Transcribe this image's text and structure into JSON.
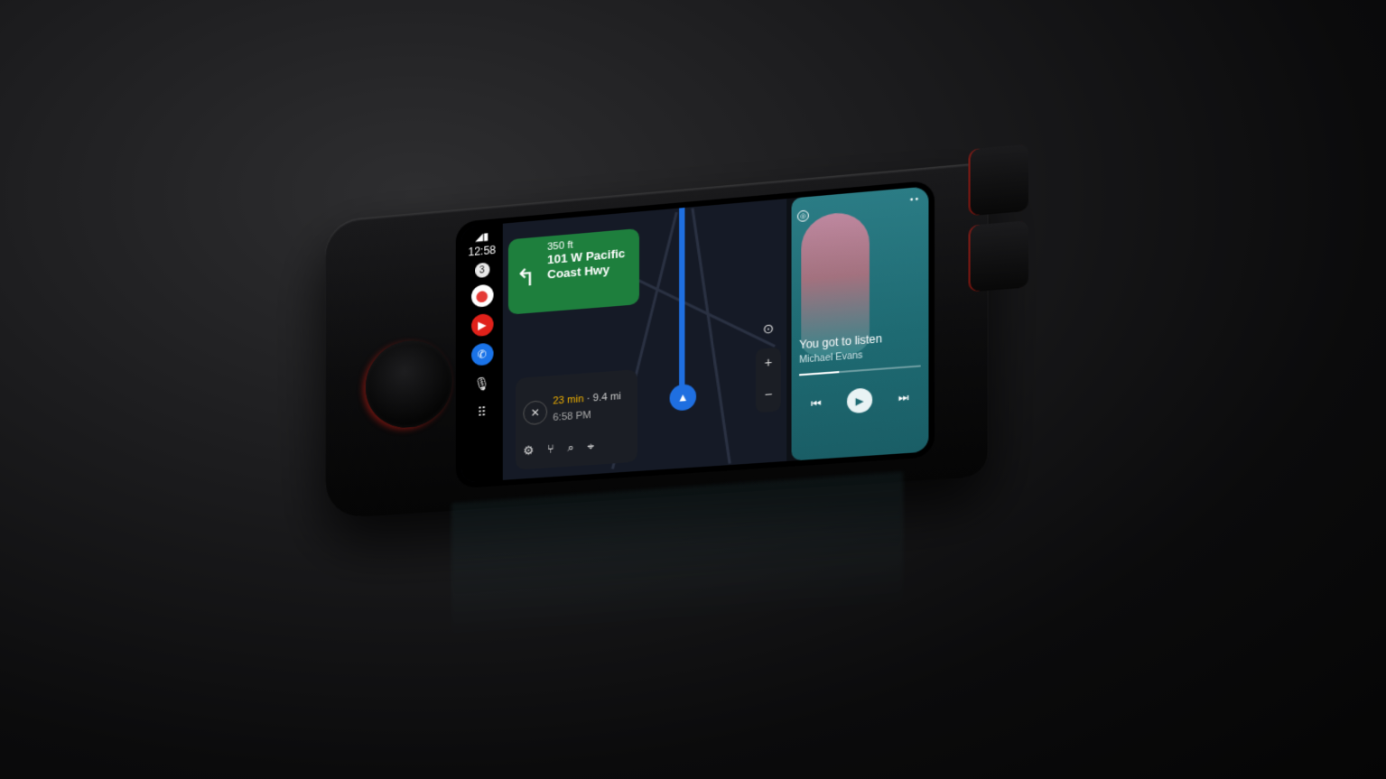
{
  "status": {
    "signal": "◢▮",
    "time": "12:58",
    "notification_count": "3"
  },
  "rail_apps": [
    {
      "name": "maps",
      "icon": "maps-pin-icon",
      "glyph": "⬤"
    },
    {
      "name": "music",
      "icon": "music-icon",
      "glyph": "▶"
    },
    {
      "name": "phone",
      "icon": "phone-icon",
      "glyph": "✆"
    }
  ],
  "rail": {
    "mic_glyph": "🎙",
    "grid_glyph": "⠿"
  },
  "navigation": {
    "distance": "350 ft",
    "road": "101 W Pacific Coast Hwy",
    "turn_glyph": "↰",
    "eta_minutes": "23 min",
    "eta_distance": " · 9.4 mi",
    "arrival_time": "6:58 PM",
    "close_glyph": "✕",
    "actions": {
      "settings": "⚙",
      "route": "⑂",
      "search": "⌕",
      "pin": "⌖"
    },
    "recenter_glyph": "⊙",
    "zoom_in": "+",
    "zoom_out": "−",
    "position_glyph": "▲"
  },
  "media": {
    "title": "You got to listen",
    "artist": "Michael Evans",
    "progress": 0.33,
    "dots": "● ●",
    "prev": "⏮",
    "play": "▶",
    "next": "⏭",
    "source_badge": "◎"
  },
  "colors": {
    "route": "#1f6fe0",
    "turn_card": "#1e7f3d",
    "media_bg": "#1e6a72",
    "eta": "#f2b200"
  }
}
